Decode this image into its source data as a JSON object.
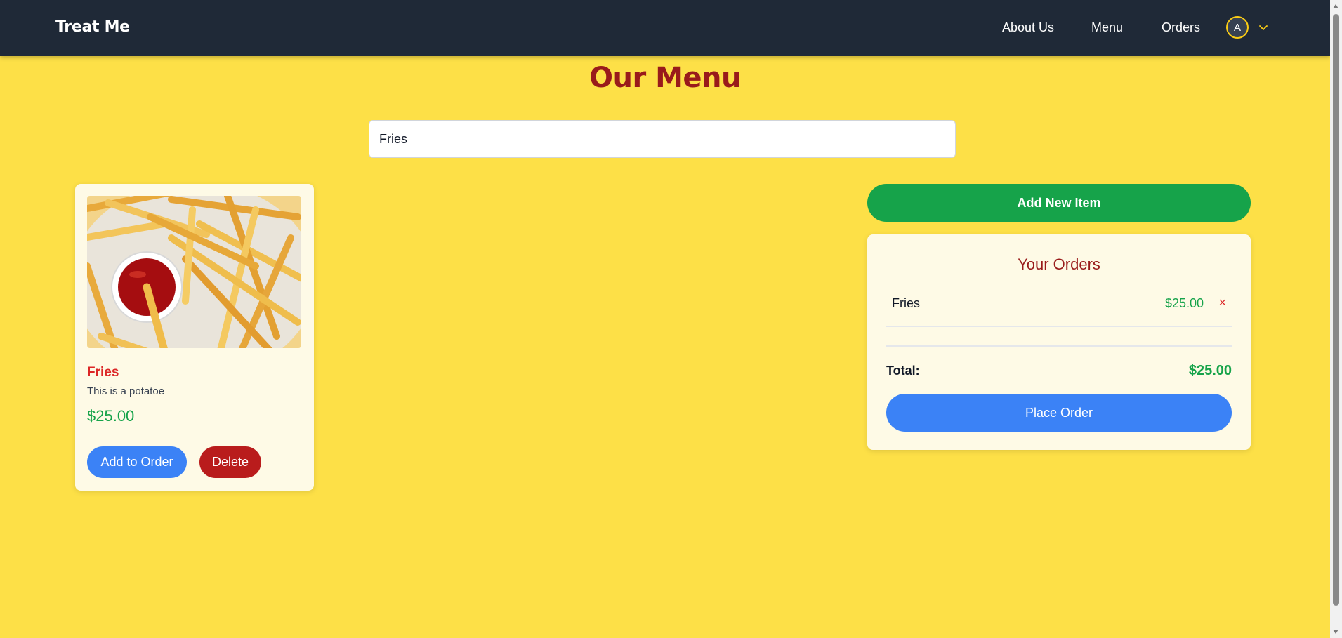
{
  "navbar": {
    "brand": "Treat Me",
    "links": [
      "About Us",
      "Menu",
      "Orders"
    ],
    "avatar_initial": "A"
  },
  "page": {
    "title": "Our Menu"
  },
  "search": {
    "value": "Fries"
  },
  "menu_items": [
    {
      "name": "Fries",
      "description": "This is a potatoe",
      "price": "$25.00",
      "add_label": "Add to Order",
      "delete_label": "Delete"
    }
  ],
  "actions": {
    "add_new_label": "Add New Item"
  },
  "orders": {
    "title": "Your Orders",
    "items": [
      {
        "name": "Fries",
        "price": "$25.00",
        "remove": "×"
      }
    ],
    "total_label": "Total:",
    "total_value": "$25.00",
    "place_label": "Place Order"
  },
  "colors": {
    "page_bg": "#fde047",
    "navbar_bg": "#1f2937",
    "title_red": "#991b1b",
    "price_green": "#16a34a",
    "primary_blue": "#3b82f6",
    "danger_red": "#b91c1c"
  }
}
